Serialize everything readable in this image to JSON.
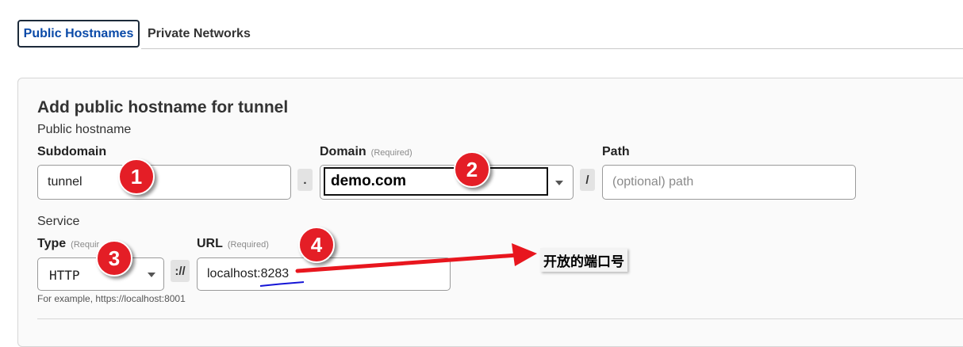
{
  "tabs": [
    {
      "label": "Public Hostnames",
      "active": true
    },
    {
      "label": "Private Networks",
      "active": false
    }
  ],
  "form": {
    "heading": "Add public hostname for tunnel",
    "public_hostname_section": "Public hostname",
    "subdomain": {
      "label": "Subdomain",
      "value": "tunnel"
    },
    "dot_separator": ".",
    "domain": {
      "label": "Domain",
      "required_text": "(Required)",
      "value": "demo.com"
    },
    "slash_separator": "/",
    "path": {
      "label": "Path",
      "placeholder": "(optional) path"
    },
    "service_section": "Service",
    "type": {
      "label": "Type",
      "required_text": "(Requir",
      "value": "HTTP",
      "hint": "For example, https://localhost:8001"
    },
    "scheme_separator": "://",
    "url": {
      "label": "URL",
      "required_text": "(Required)",
      "value_host": "localhost:",
      "value_port": "8283"
    }
  },
  "annotations": {
    "badges": [
      "1",
      "2",
      "3",
      "4"
    ],
    "note": "开放的端口号",
    "colors": {
      "badge": "#e41e26",
      "arrow": "#e8161e",
      "underline": "#1414d6"
    }
  }
}
